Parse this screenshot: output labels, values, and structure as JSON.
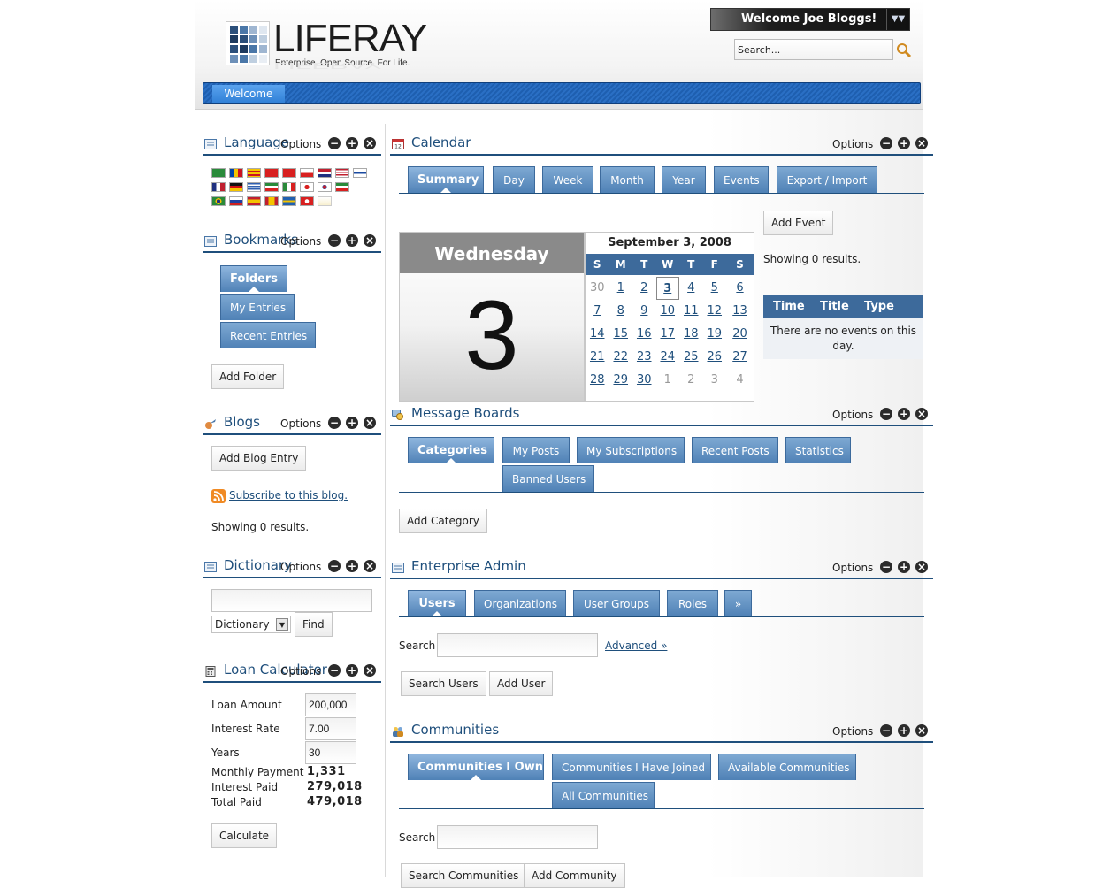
{
  "header": {
    "logo_word": "LIFERAY",
    "logo_tagline": "Enterprise. Open Source. For Life.",
    "welcome": "Welcome Joe Bloggs!",
    "search_placeholder": "Search...",
    "nav_tabs": [
      {
        "label": "Welcome"
      }
    ]
  },
  "common": {
    "options": "Options"
  },
  "language": {
    "title": "Language"
  },
  "bookmarks": {
    "title": "Bookmarks",
    "tabs": [
      "Folders",
      "My Entries",
      "Recent Entries"
    ],
    "add_folder": "Add Folder"
  },
  "blogs": {
    "title": "Blogs",
    "add_entry": "Add Blog Entry",
    "subscribe": "Subscribe to this blog.",
    "results": "Showing 0 results."
  },
  "dictionary": {
    "title": "Dictionary",
    "select_value": "Dictionary",
    "find": "Find"
  },
  "loan": {
    "title": "Loan Calculator",
    "labels": [
      "Loan Amount",
      "Interest Rate",
      "Years",
      "Monthly Payment",
      "Interest Paid",
      "Total Paid"
    ],
    "amount": "200,000",
    "rate": "7.00",
    "years": "30",
    "monthly": "1,331",
    "interest_paid": "279,018",
    "total_paid": "479,018",
    "calculate": "Calculate"
  },
  "calendar": {
    "title": "Calendar",
    "tabs": [
      "Summary",
      "Day",
      "Week",
      "Month",
      "Year",
      "Events",
      "Export / Import"
    ],
    "weekday": "Wednesday",
    "day": "3",
    "month_title": "September 3, 2008",
    "dow": [
      "S",
      "M",
      "T",
      "W",
      "T",
      "F",
      "S"
    ],
    "weeks": [
      [
        "30",
        "1",
        "2",
        "3",
        "4",
        "5",
        "6"
      ],
      [
        "7",
        "8",
        "9",
        "10",
        "11",
        "12",
        "13"
      ],
      [
        "14",
        "15",
        "16",
        "17",
        "18",
        "19",
        "20"
      ],
      [
        "21",
        "22",
        "23",
        "24",
        "25",
        "26",
        "27"
      ],
      [
        "28",
        "29",
        "30",
        "1",
        "2",
        "3",
        "4"
      ]
    ],
    "add_event": "Add Event",
    "results": "Showing 0 results.",
    "columns": [
      "Time",
      "Title",
      "Type"
    ],
    "empty": "There are no events on this day."
  },
  "message_boards": {
    "title": "Message Boards",
    "tabs": [
      "Categories",
      "My Posts",
      "My Subscriptions",
      "Recent Posts",
      "Statistics",
      "Banned Users"
    ],
    "add_category": "Add Category"
  },
  "enterprise_admin": {
    "title": "Enterprise Admin",
    "tabs": [
      "Users",
      "Organizations",
      "User Groups",
      "Roles",
      "»"
    ],
    "search_label": "Search",
    "advanced": "Advanced »",
    "search_users": "Search Users",
    "add_user": "Add User"
  },
  "communities": {
    "title": "Communities",
    "tabs": [
      "Communities I Own",
      "Communities I Have Joined",
      "Available Communities",
      "All Communities"
    ],
    "search_label": "Search",
    "search_btn": "Search Communities",
    "add_btn": "Add Community"
  }
}
